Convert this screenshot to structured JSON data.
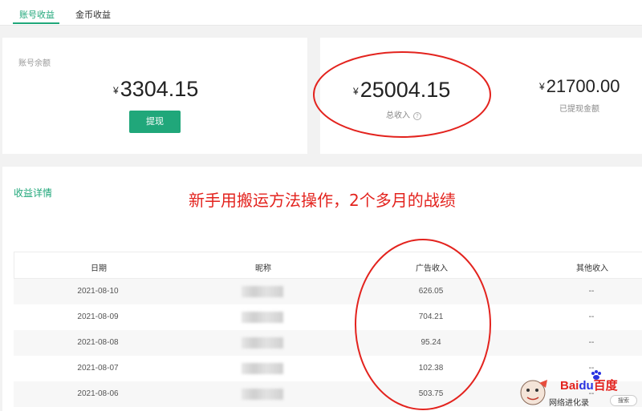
{
  "tabs": [
    {
      "label": "账号收益",
      "active": true
    },
    {
      "label": "金币收益",
      "active": false
    }
  ],
  "balance": {
    "label": "账号余额",
    "currency": "¥",
    "amount": "3304.15",
    "button": "提现"
  },
  "totals": {
    "total_currency": "¥",
    "total_amount": "25004.15",
    "total_label": "总收入",
    "withdrawn_currency": "¥",
    "withdrawn_amount": "21700.00",
    "withdrawn_label": "已提现金额"
  },
  "details": {
    "title": "收益详情",
    "annotation": "新手用搬运方法操作，2个多月的战绩",
    "columns": [
      "日期",
      "昵称",
      "广告收入",
      "其他收入"
    ],
    "rows": [
      {
        "date": "2021-08-10",
        "ad": "626.05",
        "other": "--"
      },
      {
        "date": "2021-08-09",
        "ad": "704.21",
        "other": "--"
      },
      {
        "date": "2021-08-08",
        "ad": "95.24",
        "other": "--"
      },
      {
        "date": "2021-08-07",
        "ad": "102.38",
        "other": "--"
      },
      {
        "date": "2021-08-06",
        "ad": "503.75",
        "other": "--"
      }
    ]
  },
  "watermark": {
    "logo_bai": "Bai",
    "logo_du": "du",
    "logo_cn": "百度",
    "caption": "网络进化录",
    "search": "搜索"
  },
  "colors": {
    "accent": "#20a77a",
    "annotation_red": "#e3231e"
  }
}
